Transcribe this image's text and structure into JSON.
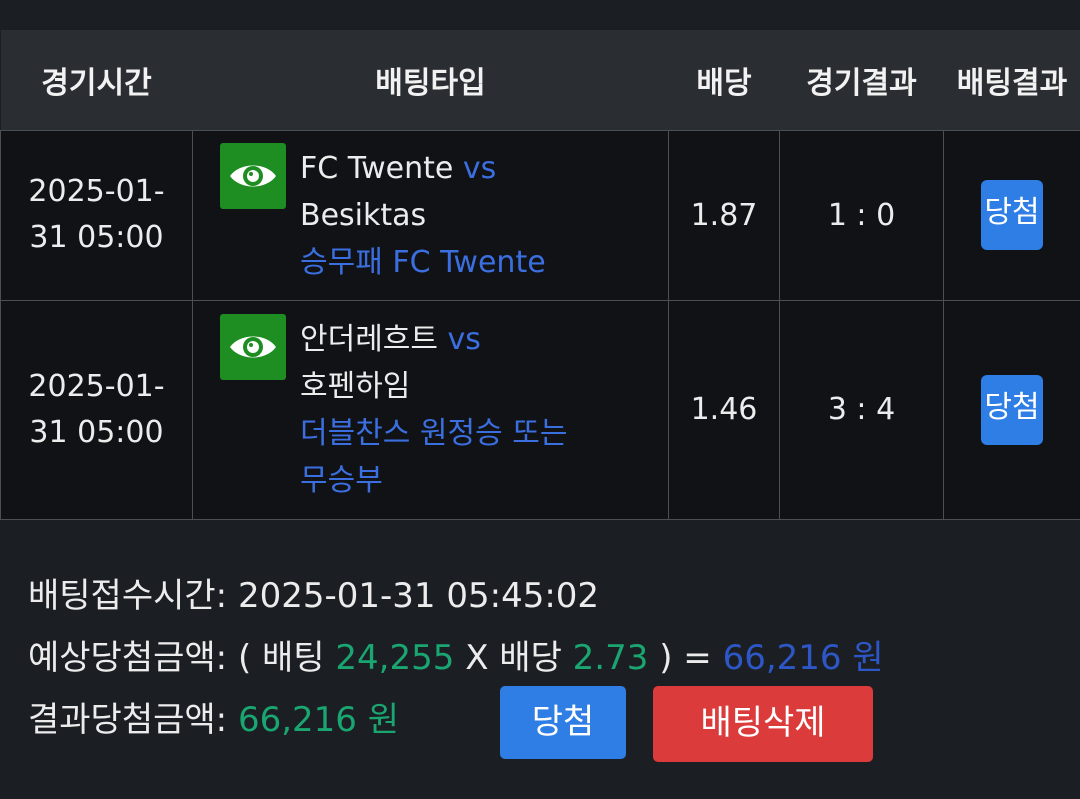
{
  "table": {
    "headers": {
      "time": "경기시간",
      "bet_type": "배팅타입",
      "odds": "배당",
      "game_result": "경기결과",
      "bet_result": "배팅결과"
    },
    "rows": [
      {
        "time_line1": "2025-01-",
        "time_line2": "31 05:00",
        "home": "FC Twente",
        "vs": "vs",
        "away": "Besiktas",
        "pick": "승무패 FC Twente",
        "odds": "1.87",
        "score": "1 : 0",
        "result": "당첨"
      },
      {
        "time_line1": "2025-01-",
        "time_line2": "31 05:00",
        "home": "안더레흐트",
        "vs": "vs",
        "away": "호펜하임",
        "pick": "더블찬스 원정승 또는 무승부",
        "odds": "1.46",
        "score": "3 : 4",
        "result": "당첨"
      }
    ]
  },
  "summary": {
    "bet_time_label": "배팅접수시간:",
    "bet_time_value": "2025-01-31 05:45:02",
    "expected_label": "예상당첨금액:",
    "paren_open": "(",
    "bet_word": "배팅",
    "bet_amount": "24,255",
    "times": "X",
    "odds_word": "배당",
    "total_odds": "2.73",
    "paren_close": ")",
    "equals": "=",
    "expected_amount": "66,216 원",
    "result_label": "결과당첨금액:",
    "result_amount": "66,216 원"
  },
  "buttons": {
    "win": "당첨",
    "delete": "배팅삭제"
  },
  "colors": {
    "accent_blue": "#2e7ee6",
    "text_blue": "#3b6fe0",
    "green": "#1aa671",
    "delete_red": "#db3b3b",
    "eye_green": "#1e8e22"
  },
  "icons": {
    "view": "eye-icon"
  }
}
